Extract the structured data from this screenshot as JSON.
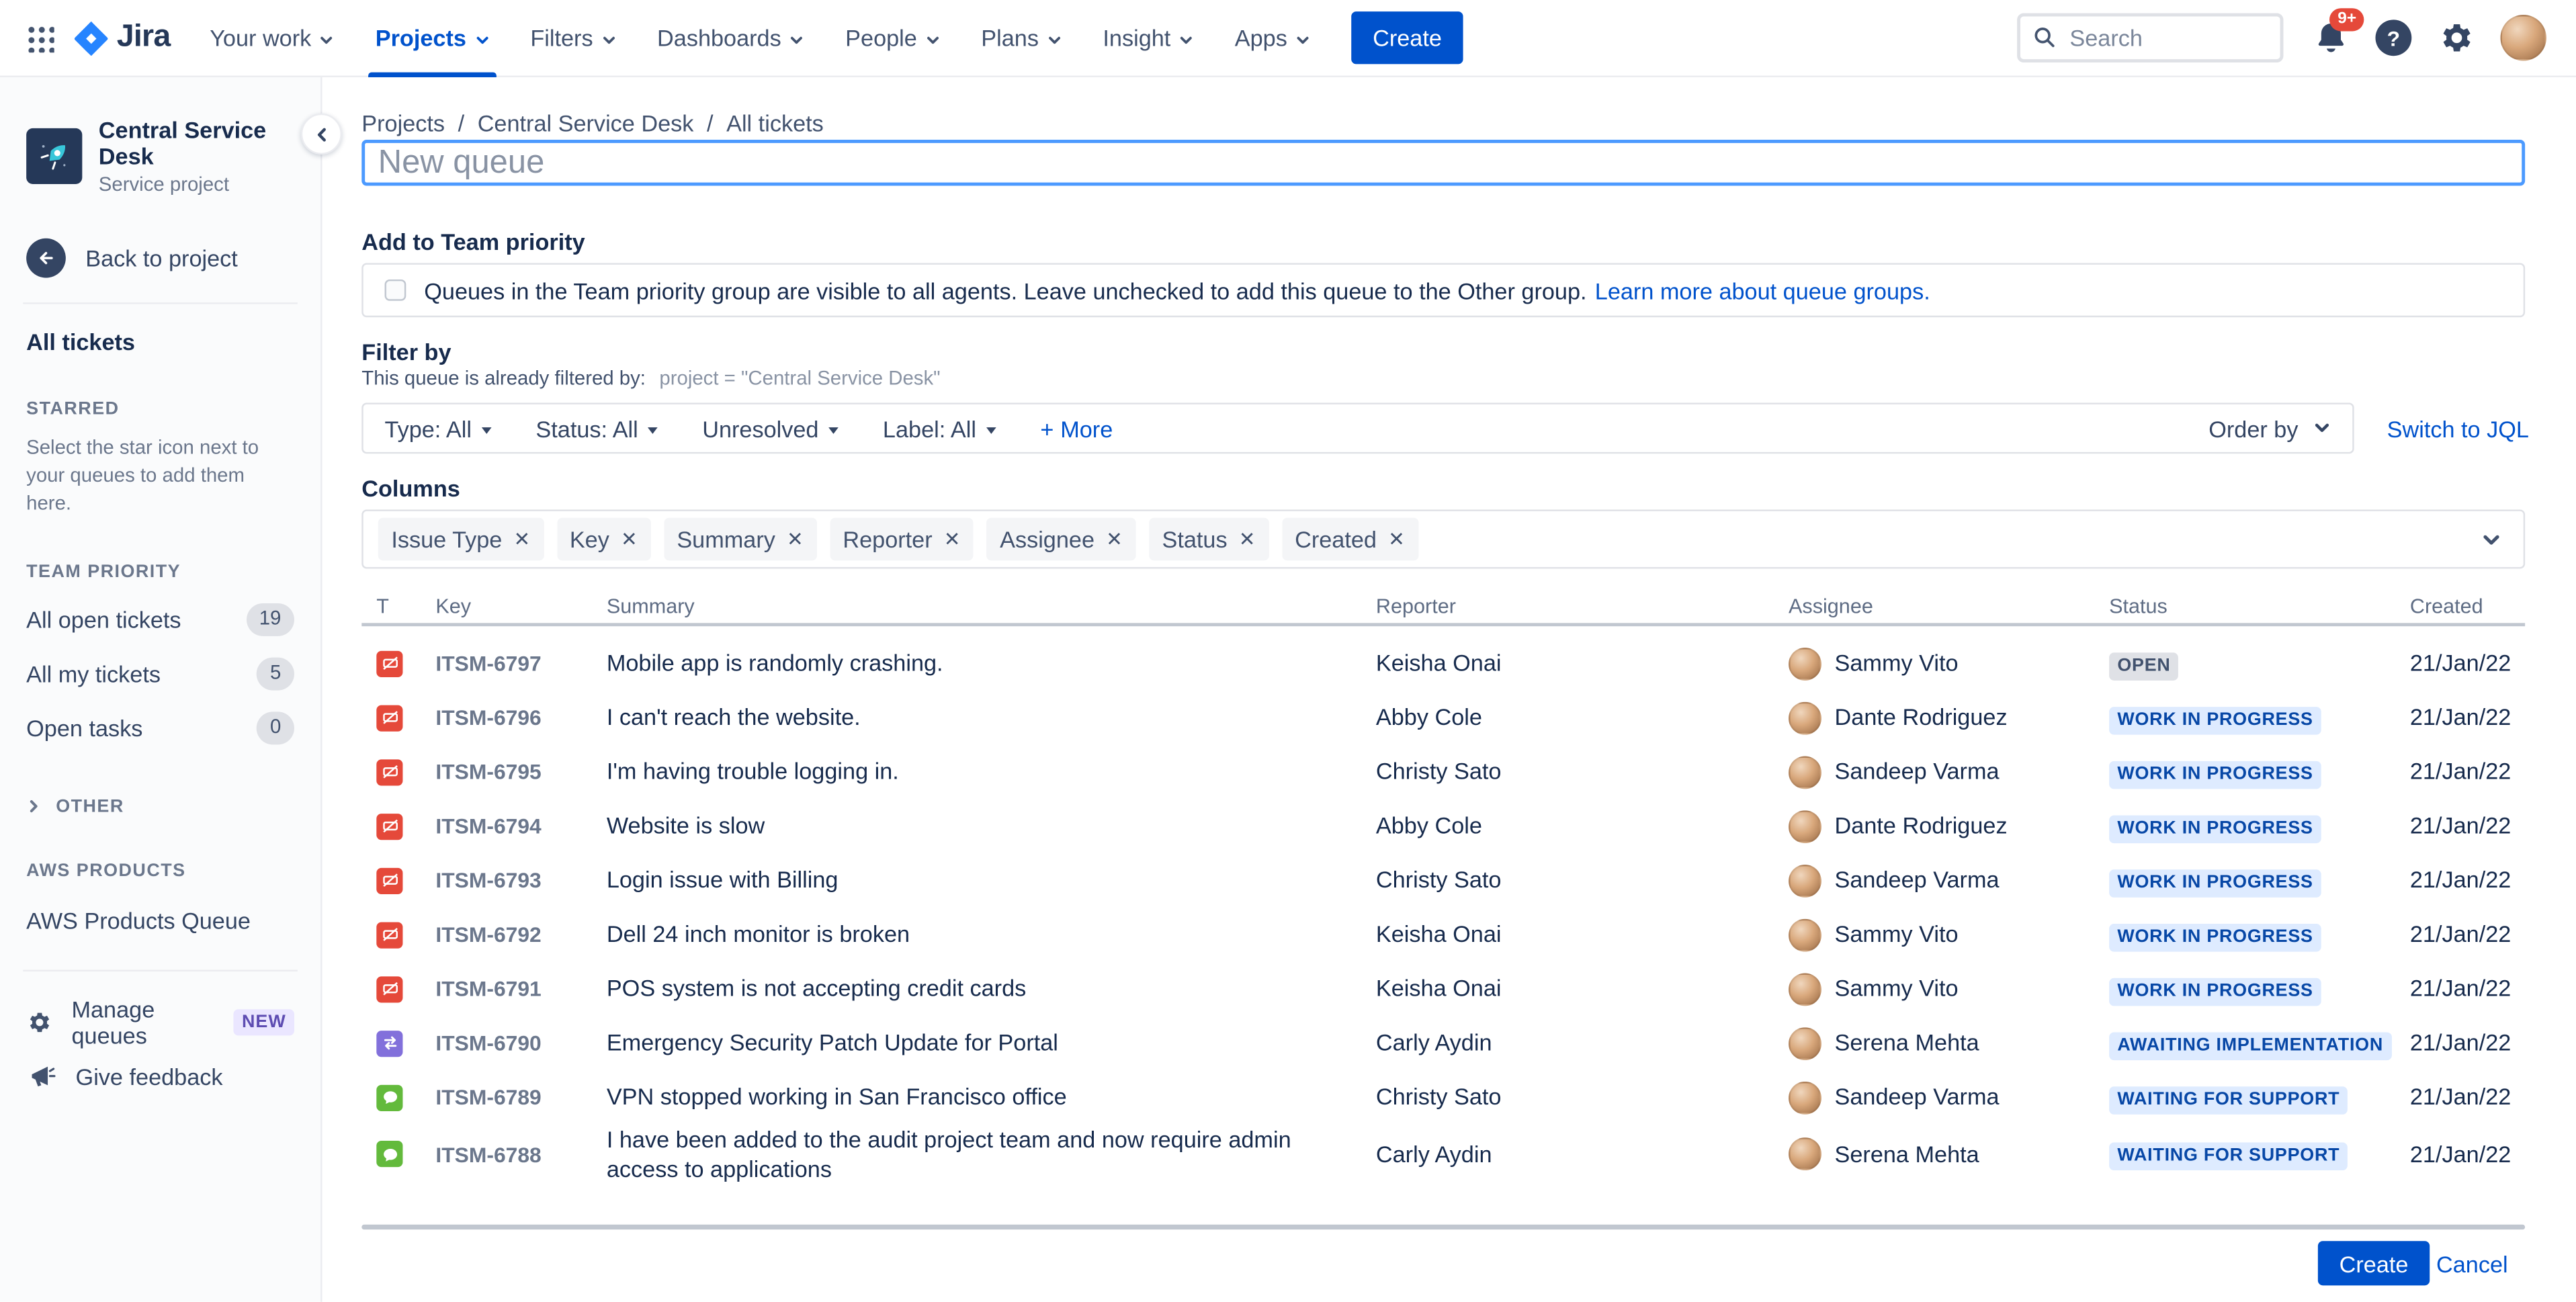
{
  "topnav": {
    "menu": [
      {
        "label": "Your work",
        "active": "false"
      },
      {
        "label": "Projects",
        "active": "true"
      },
      {
        "label": "Filters",
        "active": "false"
      },
      {
        "label": "Dashboards",
        "active": "false"
      },
      {
        "label": "People",
        "active": "false"
      },
      {
        "label": "Plans",
        "active": "false"
      },
      {
        "label": "Insight",
        "active": "false"
      },
      {
        "label": "Apps",
        "active": "false"
      }
    ],
    "logo_text": "Jira",
    "create_button": "Create",
    "search_placeholder": "Search",
    "notifications_count": "9+"
  },
  "sidebar": {
    "project_name": "Central Service Desk",
    "project_type": "Service project",
    "back_label": "Back to project",
    "all_tickets": "All tickets",
    "starred_header": "STARRED",
    "starred_hint": "Select the star icon next to your queues to add them here.",
    "team_priority_header": "TEAM PRIORITY",
    "queues": [
      {
        "label": "All open tickets",
        "count": "19"
      },
      {
        "label": "All my tickets",
        "count": "5"
      },
      {
        "label": "Open tasks",
        "count": "0"
      }
    ],
    "other_group": "OTHER",
    "aws_header": "AWS PRODUCTS",
    "aws_queue": "AWS Products Queue",
    "manage_queues": "Manage queues",
    "new_badge": "NEW",
    "give_feedback": "Give feedback"
  },
  "breadcrumb": {
    "items": [
      {
        "label": "Projects"
      },
      {
        "label": "Central Service Desk"
      },
      {
        "label": "All tickets"
      }
    ],
    "separator": "/"
  },
  "queue_form": {
    "name_placeholder": "New queue",
    "team_priority": {
      "heading": "Add to Team priority",
      "text": "Queues in the Team priority group are visible to all agents. Leave unchecked to add this queue to the Other group.",
      "link": "Learn more about queue groups."
    },
    "filter": {
      "heading": "Filter by",
      "prefilter_label": "This queue is already filtered by:",
      "prefilter_value": "project = \"Central Service Desk\"",
      "dropdowns": [
        {
          "label": "Type: All"
        },
        {
          "label": "Status: All"
        },
        {
          "label": "Unresolved"
        },
        {
          "label": "Label: All"
        }
      ],
      "more_plus": "+",
      "more": "More",
      "order_by": "Order by",
      "switch_jql": "Switch to JQL"
    },
    "columns": {
      "heading": "Columns",
      "chips": [
        {
          "label": "Issue Type"
        },
        {
          "label": "Key"
        },
        {
          "label": "Summary"
        },
        {
          "label": "Reporter"
        },
        {
          "label": "Assignee"
        },
        {
          "label": "Status"
        },
        {
          "label": "Created"
        }
      ]
    }
  },
  "table": {
    "headers": {
      "type": "T",
      "key": "Key",
      "summary": "Summary",
      "reporter": "Reporter",
      "assignee": "Assignee",
      "status": "Status",
      "created": "Created"
    },
    "rows": [
      {
        "type": "incident",
        "key": "ITSM-6797",
        "summary": "Mobile app is randomly crashing.",
        "reporter": "Keisha Onai",
        "assignee": "Sammy Vito",
        "status": "OPEN",
        "status_variant": "neutral",
        "created": "21/Jan/22"
      },
      {
        "type": "incident",
        "key": "ITSM-6796",
        "summary": "I can't reach the website.",
        "reporter": "Abby Cole",
        "assignee": "Dante Rodriguez",
        "status": "WORK IN PROGRESS",
        "status_variant": "blue",
        "created": "21/Jan/22"
      },
      {
        "type": "incident",
        "key": "ITSM-6795",
        "summary": "I'm having trouble logging in.",
        "reporter": "Christy Sato",
        "assignee": "Sandeep Varma",
        "status": "WORK IN PROGRESS",
        "status_variant": "blue",
        "created": "21/Jan/22"
      },
      {
        "type": "incident",
        "key": "ITSM-6794",
        "summary": "Website is slow",
        "reporter": "Abby Cole",
        "assignee": "Dante Rodriguez",
        "status": "WORK IN PROGRESS",
        "status_variant": "blue",
        "created": "21/Jan/22"
      },
      {
        "type": "incident",
        "key": "ITSM-6793",
        "summary": "Login issue with Billing",
        "reporter": "Christy Sato",
        "assignee": "Sandeep Varma",
        "status": "WORK IN PROGRESS",
        "status_variant": "blue",
        "created": "21/Jan/22"
      },
      {
        "type": "incident",
        "key": "ITSM-6792",
        "summary": "Dell 24 inch monitor is broken",
        "reporter": "Keisha Onai",
        "assignee": "Sammy Vito",
        "status": "WORK IN PROGRESS",
        "status_variant": "blue",
        "created": "21/Jan/22"
      },
      {
        "type": "incident",
        "key": "ITSM-6791",
        "summary": "POS system is not accepting credit cards",
        "reporter": "Keisha Onai",
        "assignee": "Sammy Vito",
        "status": "WORK IN PROGRESS",
        "status_variant": "blue",
        "created": "21/Jan/22"
      },
      {
        "type": "change",
        "key": "ITSM-6790",
        "summary": "Emergency Security Patch Update for Portal",
        "reporter": "Carly Aydin",
        "assignee": "Serena Mehta",
        "status": "AWAITING IMPLEMENTATION",
        "status_variant": "blue",
        "created": "21/Jan/22"
      },
      {
        "type": "support",
        "key": "ITSM-6789",
        "summary": "VPN stopped working in San Francisco office",
        "reporter": "Christy Sato",
        "assignee": "Sandeep Varma",
        "status": "WAITING FOR SUPPORT",
        "status_variant": "blue",
        "created": "21/Jan/22"
      },
      {
        "type": "support",
        "key": "ITSM-6788",
        "summary": "I have been added to the audit project team and now require admin access to applications",
        "reporter": "Carly Aydin",
        "assignee": "Serena Mehta",
        "status": "WAITING FOR SUPPORT",
        "status_variant": "blue",
        "created": "21/Jan/22"
      }
    ]
  },
  "footer": {
    "create": "Create",
    "cancel": "Cancel"
  },
  "colors": {
    "accent": "#0052CC",
    "focus_border": "#4C9AFF",
    "incident_icon": "#E5493A",
    "change_icon": "#8270DB",
    "support_icon": "#63BA3C",
    "status_neutral_bg": "#DFE1E6",
    "status_neutral_text": "#42526E",
    "status_blue_bg": "#DEEBFF",
    "status_blue_text": "#0747A6",
    "new_badge_bg": "#EAE6FF",
    "new_badge_text": "#5E4DB2",
    "notification_badge": "#E5493A"
  }
}
